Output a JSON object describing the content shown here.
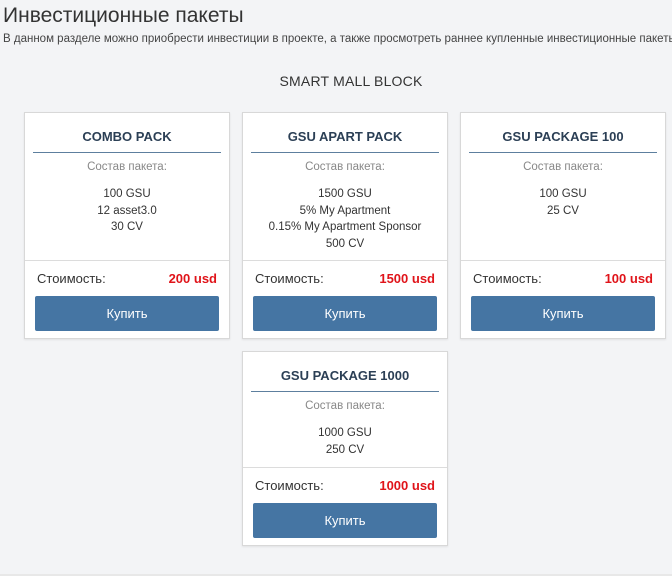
{
  "page": {
    "title": "Инвестиционные пакеты",
    "description": "В данном разделе можно приобрести инвестиции в проекте, а также просмотреть раннее купленные инвестиционные пакеты."
  },
  "section": {
    "title": "SMART MALL BLOCK"
  },
  "composition_label": "Состав пакета:",
  "price_label": "Стоимость:",
  "buy_label": "Купить",
  "packages": [
    {
      "name": "COMBO PACK",
      "items": [
        "100 GSU",
        "12 asset3.0",
        "30 CV"
      ],
      "price": "200 usd"
    },
    {
      "name": "GSU APART PACK",
      "items": [
        "1500 GSU",
        "5% My Apartment",
        "0.15% My Apartment Sponsor",
        "500 CV"
      ],
      "price": "1500 usd"
    },
    {
      "name": "GSU PACKAGE 100",
      "items": [
        "100 GSU",
        "25 CV"
      ],
      "price": "100 usd"
    },
    {
      "name": "GSU PACKAGE 1000",
      "items": [
        "1000 GSU",
        "250 CV"
      ],
      "price": "1000 usd"
    }
  ],
  "colors": {
    "button": "#4575a3",
    "price": "#e0141a",
    "title": "#2b3f55"
  }
}
